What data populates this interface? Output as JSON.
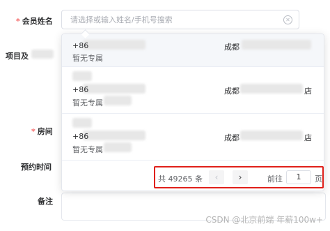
{
  "form": {
    "member_name_label": "会员姓名",
    "project_label": "项目及",
    "room_label": "房间",
    "appointment_time_label": "预约时间",
    "remarks_label": "备注",
    "required_mark": "*"
  },
  "search": {
    "placeholder": "请选择或输入姓名/手机号搜索",
    "value": ""
  },
  "options": [
    {
      "phone": "+86",
      "tag": "暂无专属",
      "store": "成都"
    },
    {
      "phone": "+86",
      "tag": "暂无专属",
      "store": "成都",
      "store_suffix": "店"
    },
    {
      "phone": "+86",
      "tag": "暂无专属",
      "store": "成都",
      "store_suffix": "店"
    }
  ],
  "pagination": {
    "total_text": "共 49265 条",
    "goto_label": "前往",
    "current_page": "1",
    "page_suffix": "页"
  },
  "watermark": "CSDN @北京前端 年薪100w+",
  "colors": {
    "required": "#f56c6c",
    "highlight_border": "#e0201a",
    "text": "#303133"
  }
}
